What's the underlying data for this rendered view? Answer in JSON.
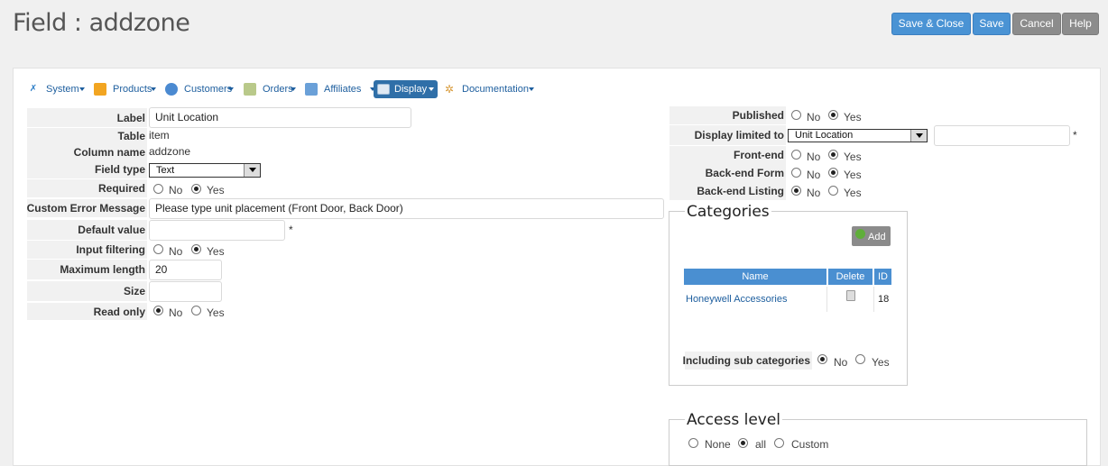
{
  "page": {
    "title": "Field : addzone"
  },
  "toolbar": {
    "save_close": "Save & Close",
    "save": "Save",
    "cancel": "Cancel",
    "help": "Help"
  },
  "menu": {
    "system": "System",
    "products": "Products",
    "customers": "Customers",
    "orders": "Orders",
    "affiliates": "Affiliates",
    "display": "Display",
    "documentation": "Documentation"
  },
  "form": {
    "label": {
      "label": "Label",
      "value": "Unit Location"
    },
    "table": {
      "label": "Table",
      "value": "item"
    },
    "column_name": {
      "label": "Column name",
      "value": "addzone"
    },
    "field_type": {
      "label": "Field type",
      "value": "Text"
    },
    "required": {
      "label": "Required",
      "no": "No",
      "yes": "Yes",
      "selected": "Yes"
    },
    "custom_error": {
      "label": "Custom Error Message",
      "value": "Please type unit placement (Front Door, Back Door)"
    },
    "default_value": {
      "label": "Default value",
      "value": "",
      "mark": "*"
    },
    "input_filtering": {
      "label": "Input filtering",
      "no": "No",
      "yes": "Yes",
      "selected": "Yes"
    },
    "maximum_length": {
      "label": "Maximum length",
      "value": "20"
    },
    "size": {
      "label": "Size",
      "value": ""
    },
    "read_only": {
      "label": "Read only",
      "no": "No",
      "yes": "Yes",
      "selected": "No"
    }
  },
  "right": {
    "published": {
      "label": "Published",
      "no": "No",
      "yes": "Yes",
      "selected": "Yes"
    },
    "display_limited": {
      "label": "Display limited to",
      "value": "Unit Location",
      "extra": "",
      "mark": "*"
    },
    "frontend": {
      "label": "Front-end",
      "no": "No",
      "yes": "Yes",
      "selected": "Yes"
    },
    "backend_form": {
      "label": "Back-end Form",
      "no": "No",
      "yes": "Yes",
      "selected": "Yes"
    },
    "backend_listing": {
      "label": "Back-end Listing",
      "no": "No",
      "yes": "Yes",
      "selected": "No"
    }
  },
  "categories": {
    "legend": "Categories",
    "add_label": "Add",
    "headers": {
      "name": "Name",
      "delete": "Delete",
      "id": "ID"
    },
    "rows": [
      {
        "name": "Honeywell Accessories",
        "id": "18"
      }
    ],
    "including_sub": {
      "label": "Including sub categories",
      "no": "No",
      "yes": "Yes",
      "selected": "No"
    }
  },
  "access": {
    "legend": "Access level",
    "none": "None",
    "all": "all",
    "custom": "Custom",
    "selected": "all"
  },
  "colors": {
    "accent": "#4a93d4",
    "grey_button": "#8c8c8c",
    "table_header": "#4a8fd1",
    "link": "#1d5e9e"
  },
  "icons": {
    "system": "wrench-icon",
    "products": "box-icon",
    "customers": "users-icon",
    "orders": "clipboard-icon",
    "affiliates": "people-icon",
    "display": "monitor-icon",
    "documentation": "gears-icon",
    "add": "plus-icon",
    "delete": "trash-icon"
  }
}
